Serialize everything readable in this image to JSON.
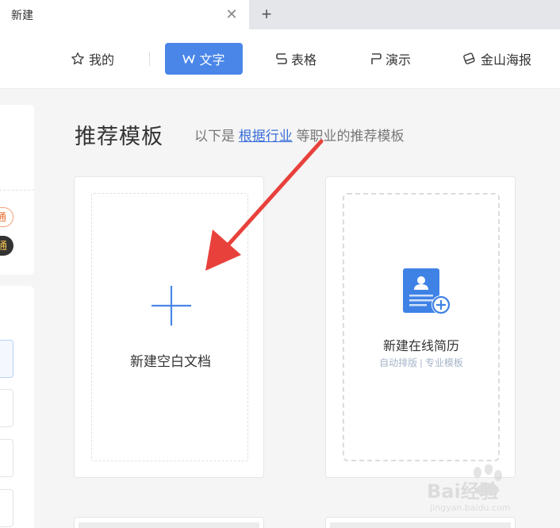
{
  "tabs": {
    "active_label": "新建",
    "close_glyph": "✕",
    "add_glyph": "+"
  },
  "nav": {
    "mine": {
      "label": "我的",
      "icon": "star-icon"
    },
    "text": {
      "label": "文字",
      "icon": "w-icon"
    },
    "sheet": {
      "label": "表格",
      "icon": "s-icon"
    },
    "present": {
      "label": "演示",
      "icon": "p-icon"
    },
    "poster": {
      "label": "金山海报",
      "icon": "poster-icon"
    },
    "active_color": "#4a86e8"
  },
  "sidebar": {
    "pill1": "通",
    "pill2": "通"
  },
  "section": {
    "title": "推荐模板",
    "desc_prefix": "以下是",
    "desc_link": "根据行业",
    "desc_suffix": "等职业的推荐模板"
  },
  "cards": {
    "blank": {
      "label": "新建空白文档",
      "icon": "plus-icon"
    },
    "resume": {
      "label": "新建在线简历",
      "sub": "自动排版 | 专业模板",
      "icon": "resume-add-icon"
    }
  },
  "watermark": {
    "brand": "Bai经验",
    "url": "jingyan.baidu.com"
  },
  "colors": {
    "accent": "#4a86e8",
    "arrow": "#e8413c",
    "link": "#3a6ed8"
  }
}
